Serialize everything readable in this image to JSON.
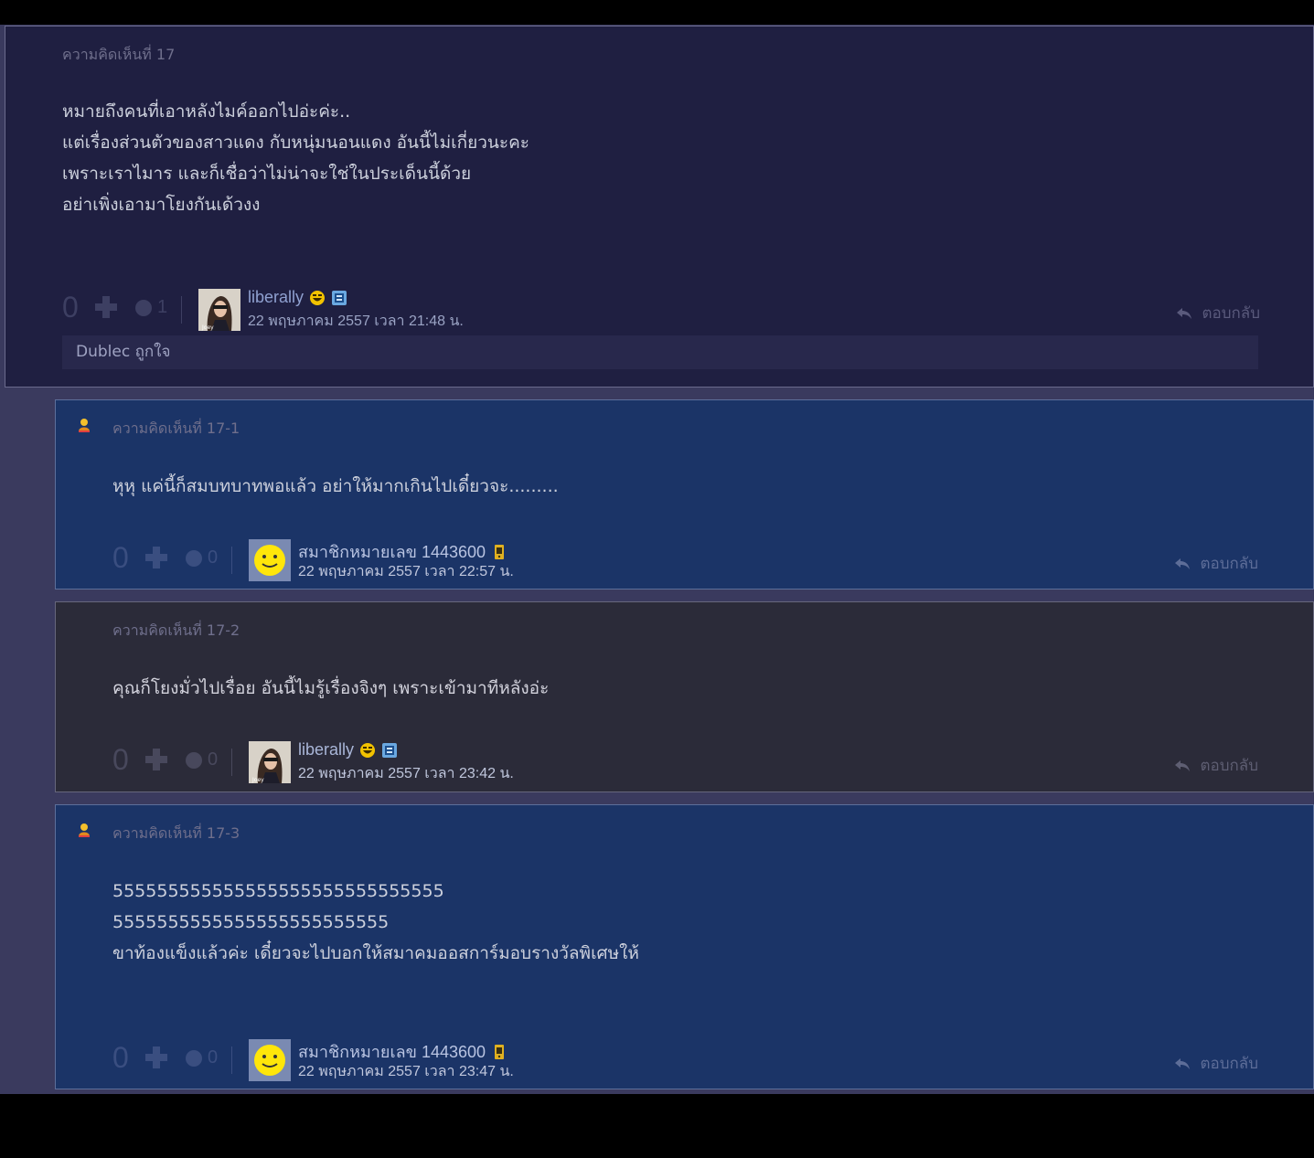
{
  "comments": [
    {
      "header": "ความคิดเห็นที่ 17",
      "lines": [
        "หมายถึงคนที่เอาหลังไมค์ออกไปอ่ะค่ะ..",
        "",
        "แต่เรื่องส่วนตัวของสาวแดง กับหนุ่มนอนแดง อันนี้ไม่เกี่ยวนะคะ",
        "เพราะเราไมาร และก็เชื่อว่าไม่น่าจะใช่ในประเด็นนี้ด้วย",
        "อย่าเพิ่งเอามาโยงกันเด้วงง"
      ],
      "vote": "0",
      "emotion_count": "1",
      "user": "liberally",
      "time": "22 พฤษภาคม 2557 เวลา 21:48 น.",
      "reply_label": "ตอบกลับ",
      "note": "Dublec ถูกใจ"
    },
    {
      "header": "ความคิดเห็นที่ 17-1",
      "lines": [
        "หุหุ แค่นี้ก็สมบทบาทพอแล้ว อย่าให้มากเกินไปเดี๋ยวจะ........."
      ],
      "vote": "0",
      "emotion_count": "0",
      "user": "สมาชิกหมายเลข 1443600",
      "time": "22 พฤษภาคม 2557 เวลา 22:57 น.",
      "reply_label": "ตอบกลับ"
    },
    {
      "header": "ความคิดเห็นที่ 17-2",
      "lines": [
        "คุณก็โยงมั่วไปเรื่อย อันนี้ไมรู้เรื่องจิงๆ เพราะเข้ามาทีหลังอ่ะ"
      ],
      "vote": "0",
      "emotion_count": "0",
      "user": "liberally",
      "time": "22 พฤษภาคม 2557 เวลา 23:42 น.",
      "reply_label": "ตอบกลับ"
    },
    {
      "header": "ความคิดเห็นที่ 17-3",
      "lines": [
        "555555555555555555555555555555",
        "5555555555555555555555555",
        "",
        "ขาท้องแข็งแล้วค่ะ เดี๋ยวจะไปบอกให้สมาคมออสการ์มอบรางวัลพิเศษให้"
      ],
      "vote": "0",
      "emotion_count": "0",
      "user": "สมาชิกหมายเลข 1443600",
      "time": "22 พฤษภาคม 2557 เวลา 23:47 น.",
      "reply_label": "ตอบกลับ"
    }
  ],
  "colors": {
    "main_bg": "#1f1f41",
    "reply_blue_bg": "#1b3467",
    "reply_dark_bg": "#2b2b39",
    "page_bg": "#3a3a5e"
  },
  "icons": [
    "plus-icon",
    "emotion-icon",
    "laugh-emoji-icon",
    "blog-badge-icon",
    "mobile-badge-icon",
    "reply-arrow-icon",
    "topic-owner-icon",
    "smiley-avatar"
  ]
}
